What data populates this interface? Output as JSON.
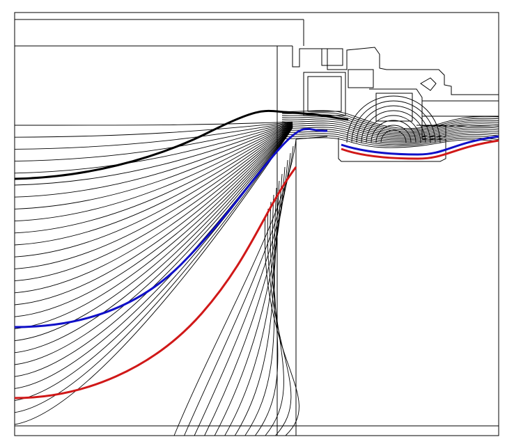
{
  "diagram": {
    "type": "isotherm-section",
    "line_color": "#000000",
    "highlight_colors": {
      "black_isotherm": "#000000",
      "blue_isotherm": "#1010c8",
      "red_isotherm": "#d01818"
    },
    "isotherm_count": 26
  }
}
